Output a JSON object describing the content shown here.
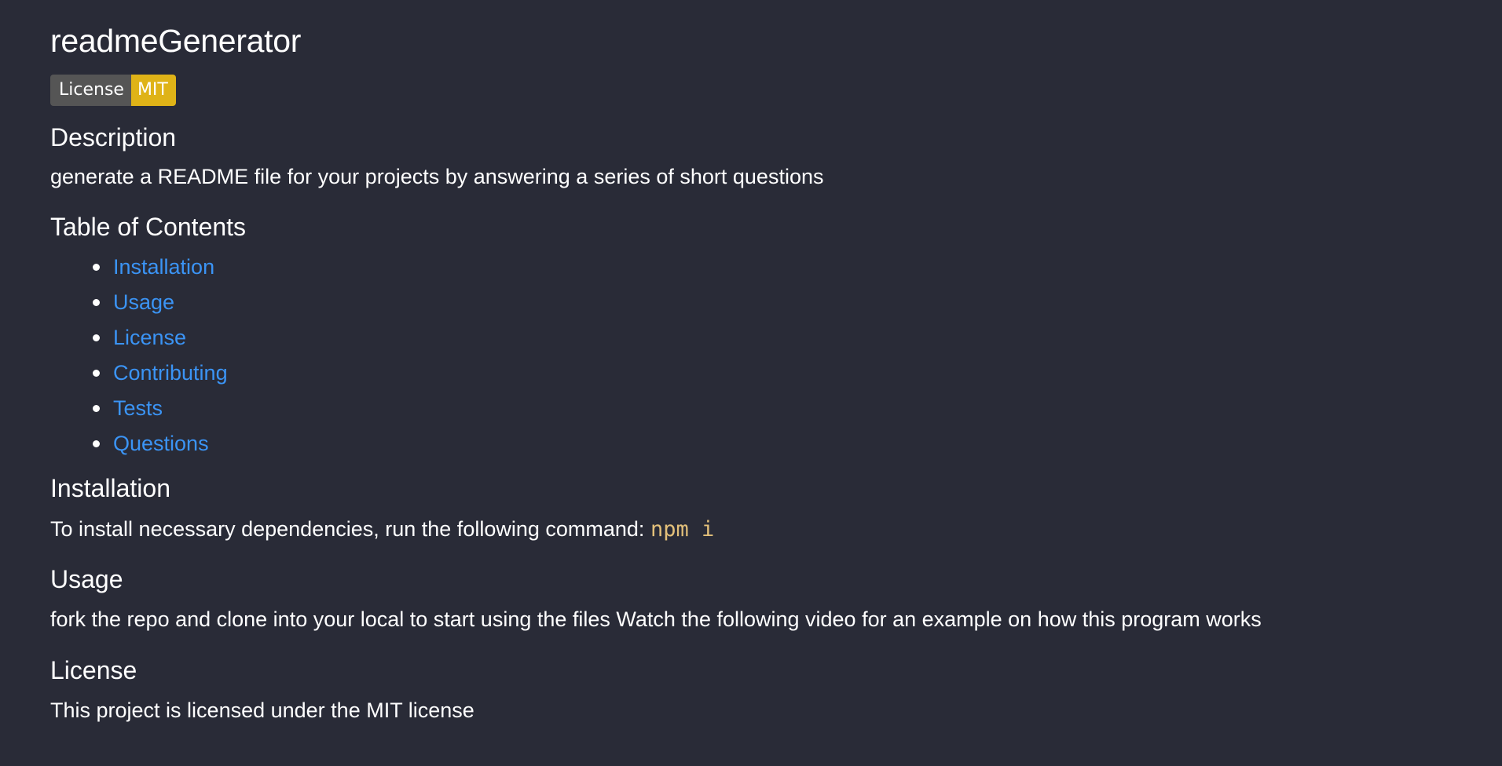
{
  "title": "readmeGenerator",
  "badge": {
    "label": "License",
    "value": "MIT",
    "label_color": "#555555",
    "value_color": "#dfb317"
  },
  "description": {
    "heading": "Description",
    "text": "generate a README file for your projects by answering a series of short questions"
  },
  "toc": {
    "heading": "Table of Contents",
    "items": [
      {
        "label": "Installation"
      },
      {
        "label": "Usage"
      },
      {
        "label": "License"
      },
      {
        "label": "Contributing"
      },
      {
        "label": "Tests"
      },
      {
        "label": "Questions"
      }
    ]
  },
  "installation": {
    "heading": "Installation",
    "text": "To install necessary dependencies, run the following command: ",
    "command": "npm i"
  },
  "usage": {
    "heading": "Usage",
    "text": "fork the repo and clone into your local to start using the files Watch the following video for an example on how this program works"
  },
  "license": {
    "heading": "License",
    "text": "This project is licensed under the MIT license"
  },
  "colors": {
    "background": "#292b37",
    "link": "#3b94f5",
    "code": "#e3c07a"
  }
}
